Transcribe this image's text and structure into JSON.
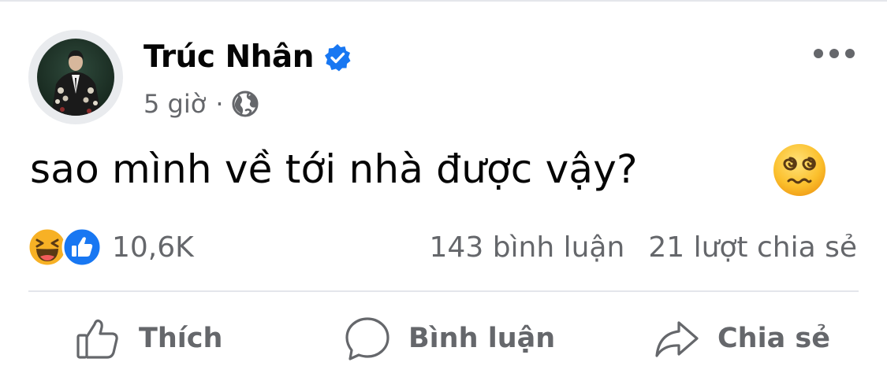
{
  "post": {
    "author": "Trúc Nhân",
    "verified": true,
    "time": "5 giờ",
    "separator": "·",
    "audience_icon": "globe-icon",
    "text": "sao mình về tới nhà được vậy?",
    "text_emoji": "dizzy-face-emoji"
  },
  "reactions": {
    "icons": [
      "haha-reaction-icon",
      "like-reaction-icon"
    ],
    "count": "10,6K"
  },
  "stats": {
    "comments": "143 bình luận",
    "shares": "21 lượt chia sẻ"
  },
  "actions": {
    "like": "Thích",
    "comment": "Bình luận",
    "share": "Chia sẻ"
  },
  "colors": {
    "primary_text": "#050505",
    "secondary_text": "#65676b",
    "divider": "#e4e6eb",
    "verified_blue": "#1877f2",
    "like_blue": "#1877f2",
    "haha_yellow": "#f7b125"
  }
}
